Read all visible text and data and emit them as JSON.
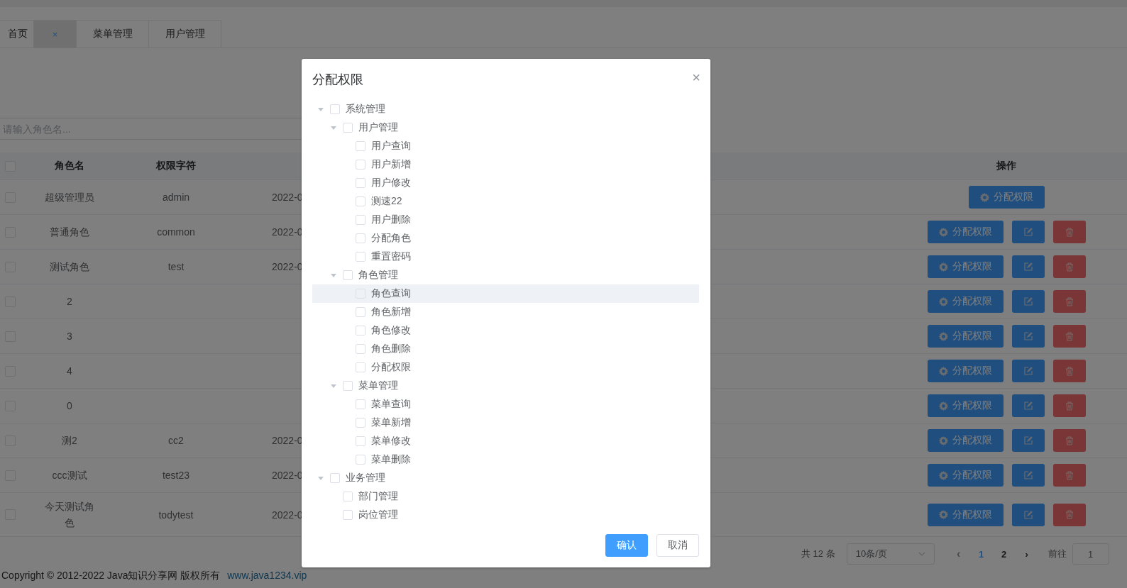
{
  "tabs": [
    {
      "label": "首页",
      "selected": false
    },
    {
      "selected": true,
      "close": "×"
    },
    {
      "label": "菜单管理",
      "selected": false
    },
    {
      "label": "用户管理",
      "selected": false
    }
  ],
  "search": {
    "placeholder": "请输入角色名..."
  },
  "table": {
    "header_checkbox": {
      "checked": false
    },
    "columns": [
      "角色名",
      "权限字符",
      "操作"
    ],
    "rows": [
      {
        "checked": false,
        "name": "超级管理员",
        "key": "admin",
        "date": "2022-0",
        "buttons": [
          {
            "kind": "assign",
            "label": "分配权限"
          }
        ]
      },
      {
        "checked": false,
        "name": "普通角色",
        "key": "common",
        "date": "2022-0",
        "buttons": [
          {
            "kind": "assign",
            "label": "分配权限"
          },
          {
            "kind": "edit"
          },
          {
            "kind": "delete"
          }
        ]
      },
      {
        "checked": false,
        "name": "测试角色",
        "key": "test",
        "date": "2022-0",
        "buttons": [
          {
            "kind": "assign",
            "label": "分配权限"
          },
          {
            "kind": "edit"
          },
          {
            "kind": "delete"
          }
        ]
      },
      {
        "checked": false,
        "name": "2",
        "buttons": [
          {
            "kind": "assign",
            "label": "分配权限"
          },
          {
            "kind": "edit"
          },
          {
            "kind": "delete"
          }
        ]
      },
      {
        "checked": false,
        "name": "3",
        "buttons": [
          {
            "kind": "assign",
            "label": "分配权限"
          },
          {
            "kind": "edit"
          },
          {
            "kind": "delete"
          }
        ]
      },
      {
        "checked": false,
        "name": "4",
        "buttons": [
          {
            "kind": "assign",
            "label": "分配权限"
          },
          {
            "kind": "edit"
          },
          {
            "kind": "delete"
          }
        ]
      },
      {
        "checked": false,
        "name": "0",
        "buttons": [
          {
            "kind": "assign",
            "label": "分配权限"
          },
          {
            "kind": "edit"
          },
          {
            "kind": "delete"
          }
        ]
      },
      {
        "checked": false,
        "name": "测2",
        "key": "cc2",
        "date": "2022-0",
        "buttons": [
          {
            "kind": "assign",
            "label": "分配权限"
          },
          {
            "kind": "edit"
          },
          {
            "kind": "delete"
          }
        ]
      },
      {
        "checked": false,
        "name": "ccc测试",
        "key": "test23",
        "date": "2022-0",
        "buttons": [
          {
            "kind": "assign",
            "label": "分配权限"
          },
          {
            "kind": "edit"
          },
          {
            "kind": "delete"
          }
        ]
      },
      {
        "checked": false,
        "name": "今天测试角色",
        "key": "todytest",
        "date": "2022-0",
        "buttons": [
          {
            "kind": "assign",
            "label": "分配权限"
          },
          {
            "kind": "edit"
          },
          {
            "kind": "delete"
          }
        ]
      }
    ]
  },
  "pagination": {
    "total": "共 12 条",
    "page_size": "10条/页",
    "prev": "‹",
    "pages": [
      {
        "label": "1",
        "selected": true
      },
      {
        "label": "2",
        "selected": false
      }
    ],
    "next": "›",
    "goto_label": "前往",
    "goto_value": "1"
  },
  "footer": {
    "text": "Copyright © 2012-2022 Java知识分享网 版权所有",
    "link": "www.java1234.vip"
  },
  "dialog": {
    "title": "分配权限",
    "close": "×",
    "tree": [
      {
        "label": "系统管理",
        "checked": false,
        "highlighted": false,
        "expanded": true,
        "children": [
          {
            "label": "用户管理",
            "checked": false,
            "highlighted": false,
            "expanded": true,
            "children": [
              {
                "label": "用户查询",
                "checked": false,
                "highlighted": false
              },
              {
                "label": "用户新增",
                "checked": false,
                "highlighted": false
              },
              {
                "label": "用户修改",
                "checked": false,
                "highlighted": false
              },
              {
                "label": "测速22",
                "checked": false,
                "highlighted": false
              },
              {
                "label": "用户删除",
                "checked": false,
                "highlighted": false
              },
              {
                "label": "分配角色",
                "checked": false,
                "highlighted": false
              },
              {
                "label": "重置密码",
                "checked": false,
                "highlighted": false
              }
            ]
          },
          {
            "label": "角色管理",
            "checked": false,
            "highlighted": false,
            "expanded": true,
            "children": [
              {
                "label": "角色查询",
                "checked": false,
                "highlighted": true
              },
              {
                "label": "角色新增",
                "checked": false,
                "highlighted": false
              },
              {
                "label": "角色修改",
                "checked": false,
                "highlighted": false
              },
              {
                "label": "角色删除",
                "checked": false,
                "highlighted": false
              },
              {
                "label": "分配权限",
                "checked": false,
                "highlighted": false
              }
            ]
          },
          {
            "label": "菜单管理",
            "checked": false,
            "highlighted": false,
            "expanded": true,
            "children": [
              {
                "label": "菜单查询",
                "checked": false,
                "highlighted": false
              },
              {
                "label": "菜单新增",
                "checked": false,
                "highlighted": false
              },
              {
                "label": "菜单修改",
                "checked": false,
                "highlighted": false
              },
              {
                "label": "菜单删除",
                "checked": false,
                "highlighted": false
              }
            ]
          }
        ]
      },
      {
        "label": "业务管理",
        "checked": false,
        "highlighted": false,
        "expanded": true,
        "children": [
          {
            "label": "部门管理",
            "checked": false,
            "highlighted": false
          },
          {
            "label": "岗位管理",
            "checked": false,
            "highlighted": false
          }
        ]
      }
    ],
    "buttons": [
      {
        "kind": "primary",
        "label": "确认"
      },
      {
        "kind": "default",
        "label": "取消"
      }
    ]
  }
}
